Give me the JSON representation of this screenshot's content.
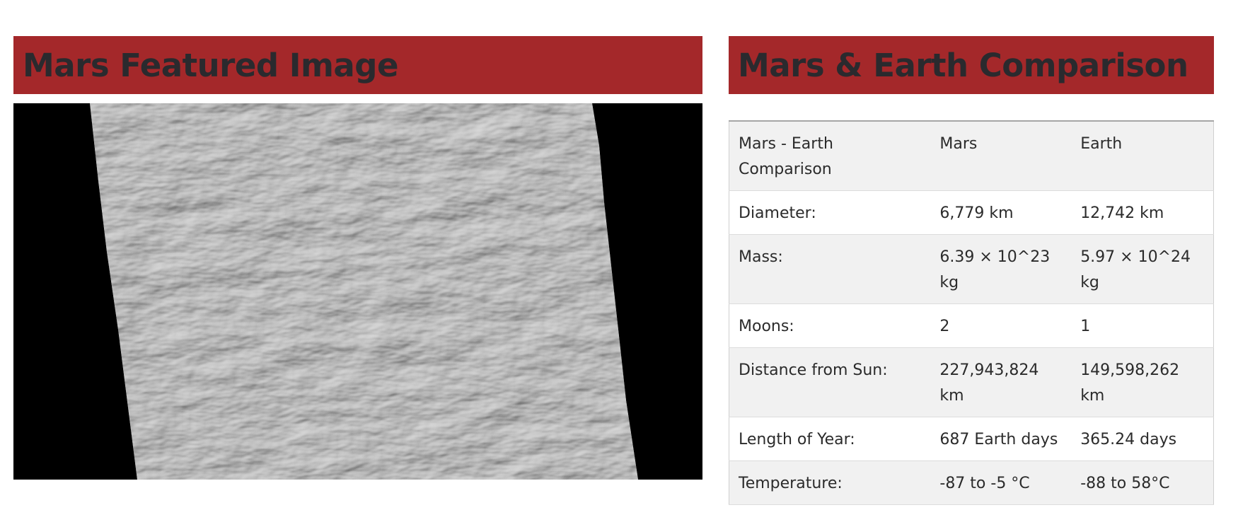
{
  "featured": {
    "title": "Mars Featured Image",
    "image_alt": "Mars surface dunes",
    "background_color": "#000000"
  },
  "comparison": {
    "title": "Mars & Earth Comparison",
    "header": [
      "Mars - Earth Comparison",
      "Mars",
      "Earth"
    ],
    "rows": [
      [
        "Diameter:",
        "6,779 km",
        "12,742 km"
      ],
      [
        "Mass:",
        "6.39 × 10^23 kg",
        "5.97 × 10^24 kg"
      ],
      [
        "Moons:",
        "2",
        "1"
      ],
      [
        "Distance from Sun:",
        "227,943,824 km",
        "149,598,262 km"
      ],
      [
        "Length of Year:",
        "687 Earth days",
        "365.24 days"
      ],
      [
        "Temperature:",
        "-87 to -5 °C",
        "-88 to 58°C"
      ]
    ]
  },
  "colors": {
    "header_background": "#a4282a",
    "header_text": "#2a2a2e",
    "row_stripe": "#f1f1f1"
  }
}
